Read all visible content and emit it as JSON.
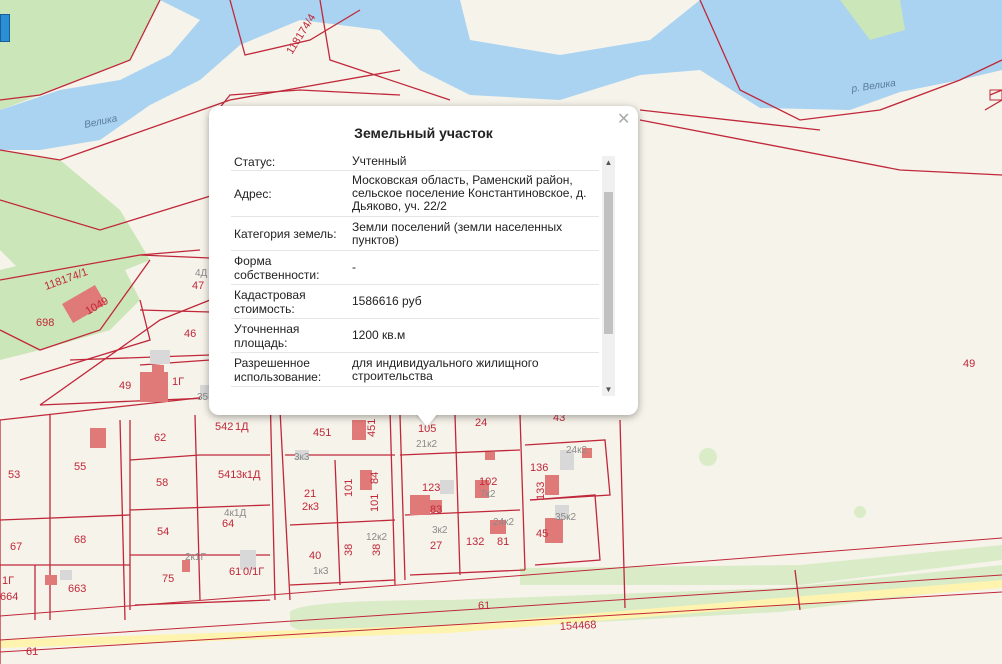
{
  "popup": {
    "title": "Земельный участок",
    "close_icon": "close-icon",
    "rows": [
      {
        "key": "Статус:",
        "value": "Учтенный"
      },
      {
        "key": "Адрес:",
        "value": "Московская область, Раменский район, сельское поселение Константиновское, д. Дьяково, уч. 22/2"
      },
      {
        "key": "Категория земель:",
        "value": "Земли поселений (земли населенных пунктов)"
      },
      {
        "key": "Форма собственности:",
        "value": "-"
      },
      {
        "key": "Кадастровая стоимость:",
        "value": "1586616 руб"
      },
      {
        "key": "Уточненная площадь:",
        "value": "1200 кв.м"
      },
      {
        "key": "Разрешенное использование:",
        "value": "для индивидуального жилищного строительства"
      }
    ]
  },
  "map": {
    "colors": {
      "water": "#a9d3f0",
      "green": "#cbe6b8",
      "background": "#f6f3ea",
      "boundary": "#c0283a",
      "building": "#e07a78",
      "road": "#fff3b0"
    },
    "water_labels": [
      "р. Велика",
      "Велика"
    ],
    "parcel_labels": [
      "118174/4",
      "118174/1",
      "1049",
      "698",
      "47",
      "46",
      "49",
      "35",
      "4Д",
      "1Г",
      "542",
      "1Д",
      "62",
      "58",
      "541",
      "3к1Д",
      "64",
      "4к1Д",
      "54",
      "2к1Г",
      "61",
      "0/1Г",
      "75",
      "53",
      "55",
      "67",
      "68",
      "663",
      "664",
      "1Г",
      "451",
      "451",
      "3к3",
      "21",
      "2к3",
      "101",
      "84",
      "101",
      "38",
      "40",
      "12к2",
      "38",
      "1к3",
      "105",
      "21к2",
      "24",
      "123",
      "102",
      "7к2",
      "83",
      "3к2",
      "24к2",
      "27",
      "132",
      "81",
      "136",
      "24к2",
      "133",
      "45",
      "35к2",
      "43",
      "49",
      "61",
      "154468",
      "61"
    ]
  }
}
